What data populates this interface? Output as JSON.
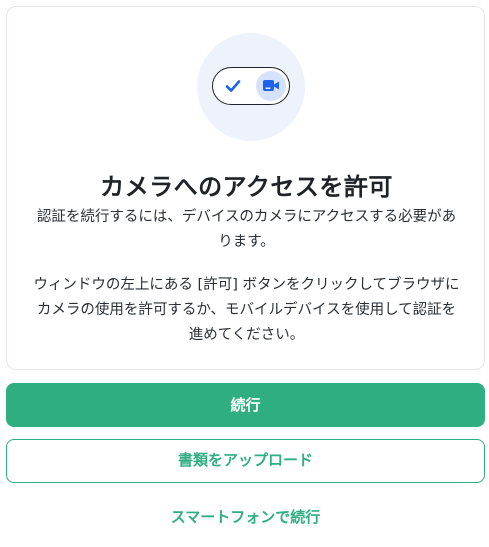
{
  "card": {
    "title": "カメラへのアクセスを許可",
    "description": "認証を続行するには、デバイスのカメラにアクセスする必要があります。",
    "instructions": "ウィンドウの左上にある [許可] ボタンをクリックしてブラウザにカメラの使用を許可するか、モバイルデバイスを使用して認証を進めてください。",
    "illustration": {
      "check_icon": "check-icon",
      "camera_icon": "video-camera-icon"
    }
  },
  "actions": {
    "continue_label": "続行",
    "upload_label": "書類をアップロード",
    "smartphone_label": "スマートフォンで続行"
  },
  "colors": {
    "accent": "#2fae82",
    "illustration_bg": "#eef2fb",
    "icon_blue": "#1d63ed"
  }
}
